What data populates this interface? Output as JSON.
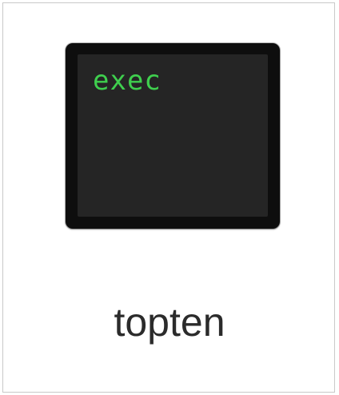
{
  "file": {
    "name": "topten",
    "icon": {
      "type": "unix-executable-icon",
      "label": "exec",
      "label_color": "#3fcf4e",
      "screen_color": "#252525",
      "bezel_color": "#0e0e0e"
    }
  }
}
